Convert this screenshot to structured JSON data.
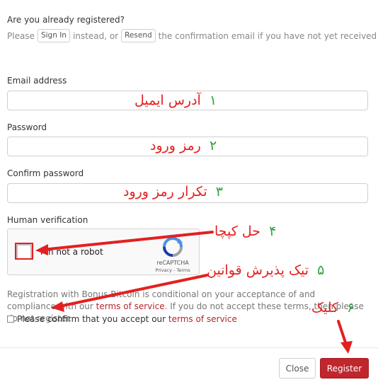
{
  "header": {
    "question": "Are you already registered?",
    "please": "Please",
    "sign_in_label": "Sign In",
    "instead_or": "instead, or",
    "resend_label": "Resend",
    "resend_tail": "the confirmation email if you have not yet received it"
  },
  "form": {
    "email_label": "Email address",
    "password_label": "Password",
    "confirm_label": "Confirm password",
    "human_label": "Human verification"
  },
  "captcha": {
    "checkbox_text": "I'm not a robot",
    "brand": "reCAPTCHA",
    "links": "Privacy - Terms"
  },
  "terms": {
    "before": "Registration with Bonus Bitcoin is conditional on your acceptance of and compliance with our",
    "link": "terms of service",
    "after": ". If you do not accept these terms, then please do not register.",
    "confirm_text": "Please confirm that you accept our",
    "confirm_link": "terms of service"
  },
  "footer": {
    "close_label": "Close",
    "register_label": "Register"
  },
  "annotations": {
    "a1_text": "آدرس ایمیل",
    "a1_num": "۱",
    "a2_text": "رمز ورود",
    "a2_num": "۲",
    "a3_text": "تکرار رمز ورود",
    "a3_num": "۳",
    "a4_text": "حل کپچا",
    "a4_num": "۴",
    "a5_text": "تیک پذیرش قوانین",
    "a5_num": "۵",
    "a6_text": "کلیک",
    "a6_num": "۶",
    "text_color": "#e32020",
    "num_color": "#2ea43a"
  },
  "colors": {
    "accent": "#c0262d",
    "link": "#b5262a"
  }
}
